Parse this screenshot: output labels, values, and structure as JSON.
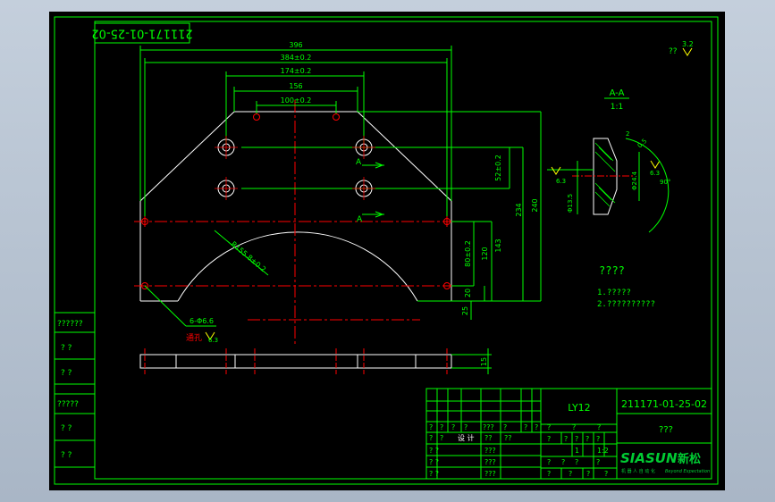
{
  "colors": {
    "border": "#00ff00",
    "geometry": "#ffffff",
    "dimension": "#00ff00",
    "centerline": "#ff0000",
    "hole": "#ffffff",
    "brand": "#00cc33",
    "surface_mark": "#ffff00"
  },
  "drawing_number_rotated": "211171-01-25-02",
  "drawing_number": "211171-01-25-02",
  "material": "LY12",
  "part_name": "???",
  "roughness_other": {
    "label": "??",
    "value": "3.2"
  },
  "dims": {
    "d396": "396",
    "d384": "384±0.2",
    "d174": "174±0.2",
    "d156": "156",
    "d100": "100±0.2",
    "d52": "52±0.2",
    "d234": "234",
    "d240": "240",
    "d120": "120",
    "d143": "143",
    "d80": "80±0.2",
    "d20": "20",
    "d25": "25",
    "d15": "15",
    "r": "R155.8±0.2",
    "holes": "6-Φ6.6",
    "thru": "通孔",
    "holes_ra": "6.3"
  },
  "section": {
    "title": "A-A",
    "scale": "1:1",
    "ra1": "6.3",
    "ra2": "6.3",
    "d_inner": "Φ13.5",
    "d_outer": "Φ24.4",
    "depth": "2",
    "angle": "90°",
    "chamfer": "0.5"
  },
  "section_marks": {
    "a1": "A",
    "a2": "A"
  },
  "notes": {
    "title": "????",
    "line1": "1.?????",
    "line2": "2.??????????"
  },
  "left_blocks": [
    "??????",
    "?  ?",
    "?  ?",
    "?????",
    "?  ?",
    "?  ?"
  ],
  "title_block": {
    "rev_row_a": [
      "?",
      "?",
      "?",
      "?",
      "???",
      "?",
      "?",
      "?"
    ],
    "rev_row_b": [
      "?",
      "?",
      "?",
      "?",
      "???",
      "?",
      "?",
      "?"
    ],
    "sign_row": [
      "?",
      "?",
      "??",
      "??",
      "??",
      "?",
      "?",
      "?"
    ],
    "design_label": "设 计",
    "rows": [
      {
        "a": "?  ?",
        "b": "???"
      },
      {
        "a": "?  ?",
        "b": "???"
      },
      {
        "a": "?  ?",
        "b": ""
      },
      {
        "a": "?  ?",
        "b": "???"
      }
    ],
    "stage_labels": [
      "?",
      "?",
      "?"
    ],
    "grid_row1": [
      "?",
      "?",
      "?",
      "?",
      "?"
    ],
    "grid_row2": [
      "?",
      "?",
      "?",
      "?"
    ],
    "scale_val": "1",
    "ratio_val": "1:2",
    "bottom_row": [
      "?",
      "?",
      "?",
      "?"
    ],
    "page_row": [
      "?",
      "?",
      "?",
      "?"
    ]
  },
  "brand": {
    "name": "SIASUN",
    "cn": "新松",
    "tagline_cn": "机 器 人 自 动 化",
    "tagline_en": "Beyond Expectation"
  }
}
